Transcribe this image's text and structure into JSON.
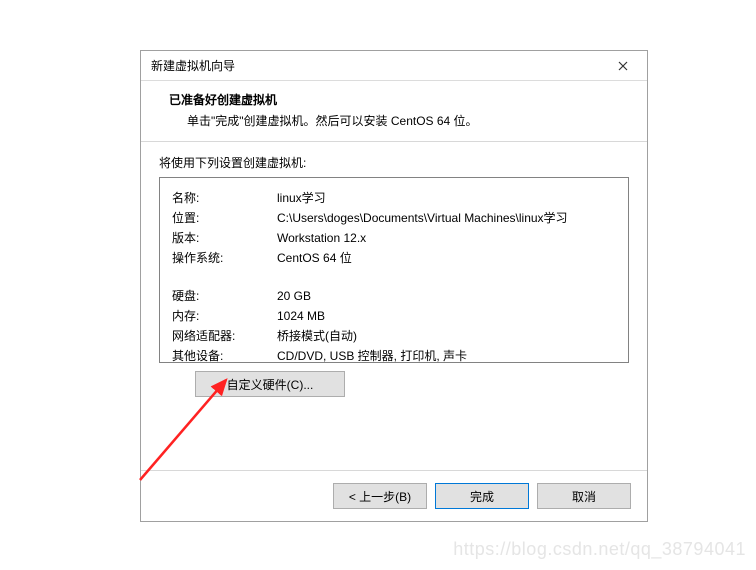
{
  "dialog": {
    "title": "新建虚拟机向导",
    "header_title": "已准备好创建虚拟机",
    "header_desc": "单击\"完成\"创建虚拟机。然后可以安装 CentOS 64 位。",
    "body_label": "将使用下列设置创建虚拟机:",
    "rows": [
      {
        "key": "名称:",
        "val": "linux学习"
      },
      {
        "key": "位置:",
        "val": "C:\\Users\\doges\\Documents\\Virtual Machines\\linux学习"
      },
      {
        "key": "版本:",
        "val": "Workstation 12.x"
      },
      {
        "key": "操作系统:",
        "val": "CentOS 64 位"
      }
    ],
    "rows2": [
      {
        "key": "硬盘:",
        "val": "20 GB"
      },
      {
        "key": "内存:",
        "val": "1024 MB"
      },
      {
        "key": "网络适配器:",
        "val": "桥接模式(自动)"
      },
      {
        "key": "其他设备:",
        "val": "CD/DVD, USB 控制器, 打印机, 声卡"
      }
    ],
    "customize_hw": "自定义硬件(C)...",
    "back": "< 上一步(B)",
    "finish": "完成",
    "cancel": "取消"
  },
  "watermark": "https://blog.csdn.net/qq_38794041"
}
